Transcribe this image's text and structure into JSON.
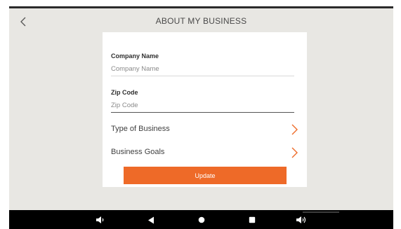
{
  "header": {
    "title": "ABOUT MY BUSINESS",
    "back_icon": "chevron-left-icon"
  },
  "form": {
    "company_name": {
      "label": "Company Name",
      "placeholder": "Company Name",
      "value": ""
    },
    "zip_code": {
      "label": "Zip Code",
      "placeholder": "Zip Code",
      "value": ""
    },
    "rows": [
      {
        "label": "Type of Business",
        "icon": "chevron-right-icon"
      },
      {
        "label": "Business Goals",
        "icon": "chevron-right-icon"
      }
    ],
    "update_label": "Update"
  },
  "nav_bar": {
    "buttons": [
      "volume-down-icon",
      "back-triangle-icon",
      "home-circle-icon",
      "recents-square-icon",
      "volume-up-icon"
    ]
  },
  "colors": {
    "accent": "#ee6a28",
    "screen_background": "#e8e7e3",
    "card_background": "#ffffff",
    "divider_light": "#d9d9d9",
    "divider_dark": "#555555"
  }
}
